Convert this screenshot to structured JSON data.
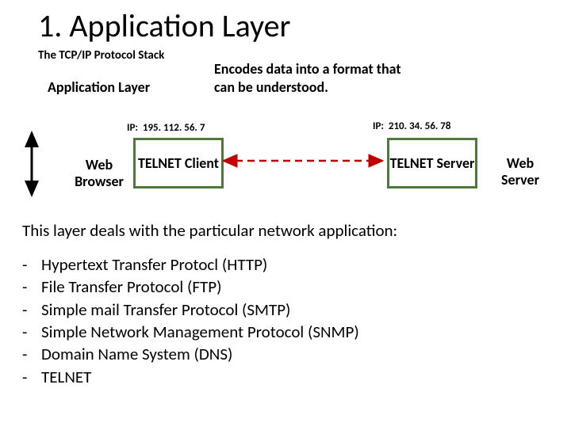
{
  "title": "1. Application Layer",
  "subtitle": "The TCP/IP Protocol Stack",
  "section_label": "Application Layer",
  "description": "Encodes data into a format that can be understood.",
  "ip_left_prefix": "IP:",
  "ip_left": "195. 112. 56. 7",
  "ip_right_prefix": "IP:",
  "ip_right": "210. 34. 56. 78",
  "telnet_client": "TELNET Client",
  "telnet_server": "TELNET Server",
  "web_browser": "Web Browser",
  "web_server": "Web Server",
  "summary": "This layer deals with the particular network application:",
  "protocols": {
    "p0": "Hypertext Transfer Protocl (HTTP)",
    "p1": "File Transfer Protocol (FTP)",
    "p2": "Simple mail Transfer Protocol (SMTP)",
    "p3": "Simple Network Management Protocol (SNMP)",
    "p4": "Domain Name System (DNS)",
    "p5": "TELNET"
  },
  "colors": {
    "box_border": "#4d7a3a",
    "arrow_red": "#c00000",
    "arrow_black": "#000000"
  }
}
